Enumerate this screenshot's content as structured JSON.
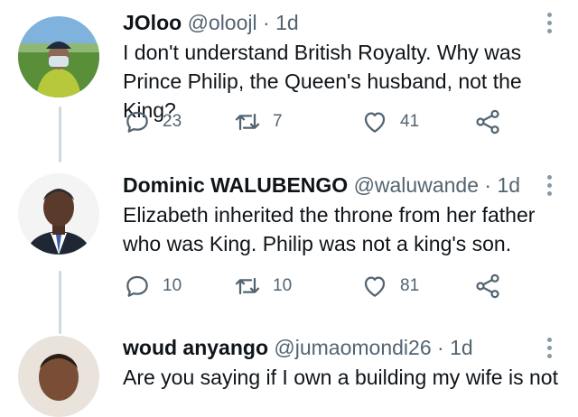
{
  "tweets": [
    {
      "name": "JOloo",
      "handle": "@oloojl",
      "time": "1d",
      "text_lines": [
        "I don't understand British Royalty. Why was",
        "Prince Philip, the Queen's husband, not the King?"
      ],
      "replies": "23",
      "retweets": "7",
      "likes": "41"
    },
    {
      "name": "Dominic WALUBENGO",
      "handle": "@waluwande",
      "time": "1d",
      "text_lines": [
        "Elizabeth inherited the throne from her father",
        "who was King. Philip was not a king's son."
      ],
      "replies": "10",
      "retweets": "10",
      "likes": "81"
    },
    {
      "name": "woud anyango",
      "handle": "@jumaomondi26",
      "time": "1d",
      "text_lines": [
        "Are you saying if I own a building my wife is not"
      ]
    }
  ],
  "separator": "·",
  "icons": {
    "reply": "reply-icon",
    "retweet": "retweet-icon",
    "like": "heart-icon",
    "share": "share-icon",
    "more": "more-vertical-icon"
  },
  "colors": {
    "text": "#0f1419",
    "secondary": "#536471",
    "icon": "#536471",
    "thread_line": "#cfd9de"
  }
}
